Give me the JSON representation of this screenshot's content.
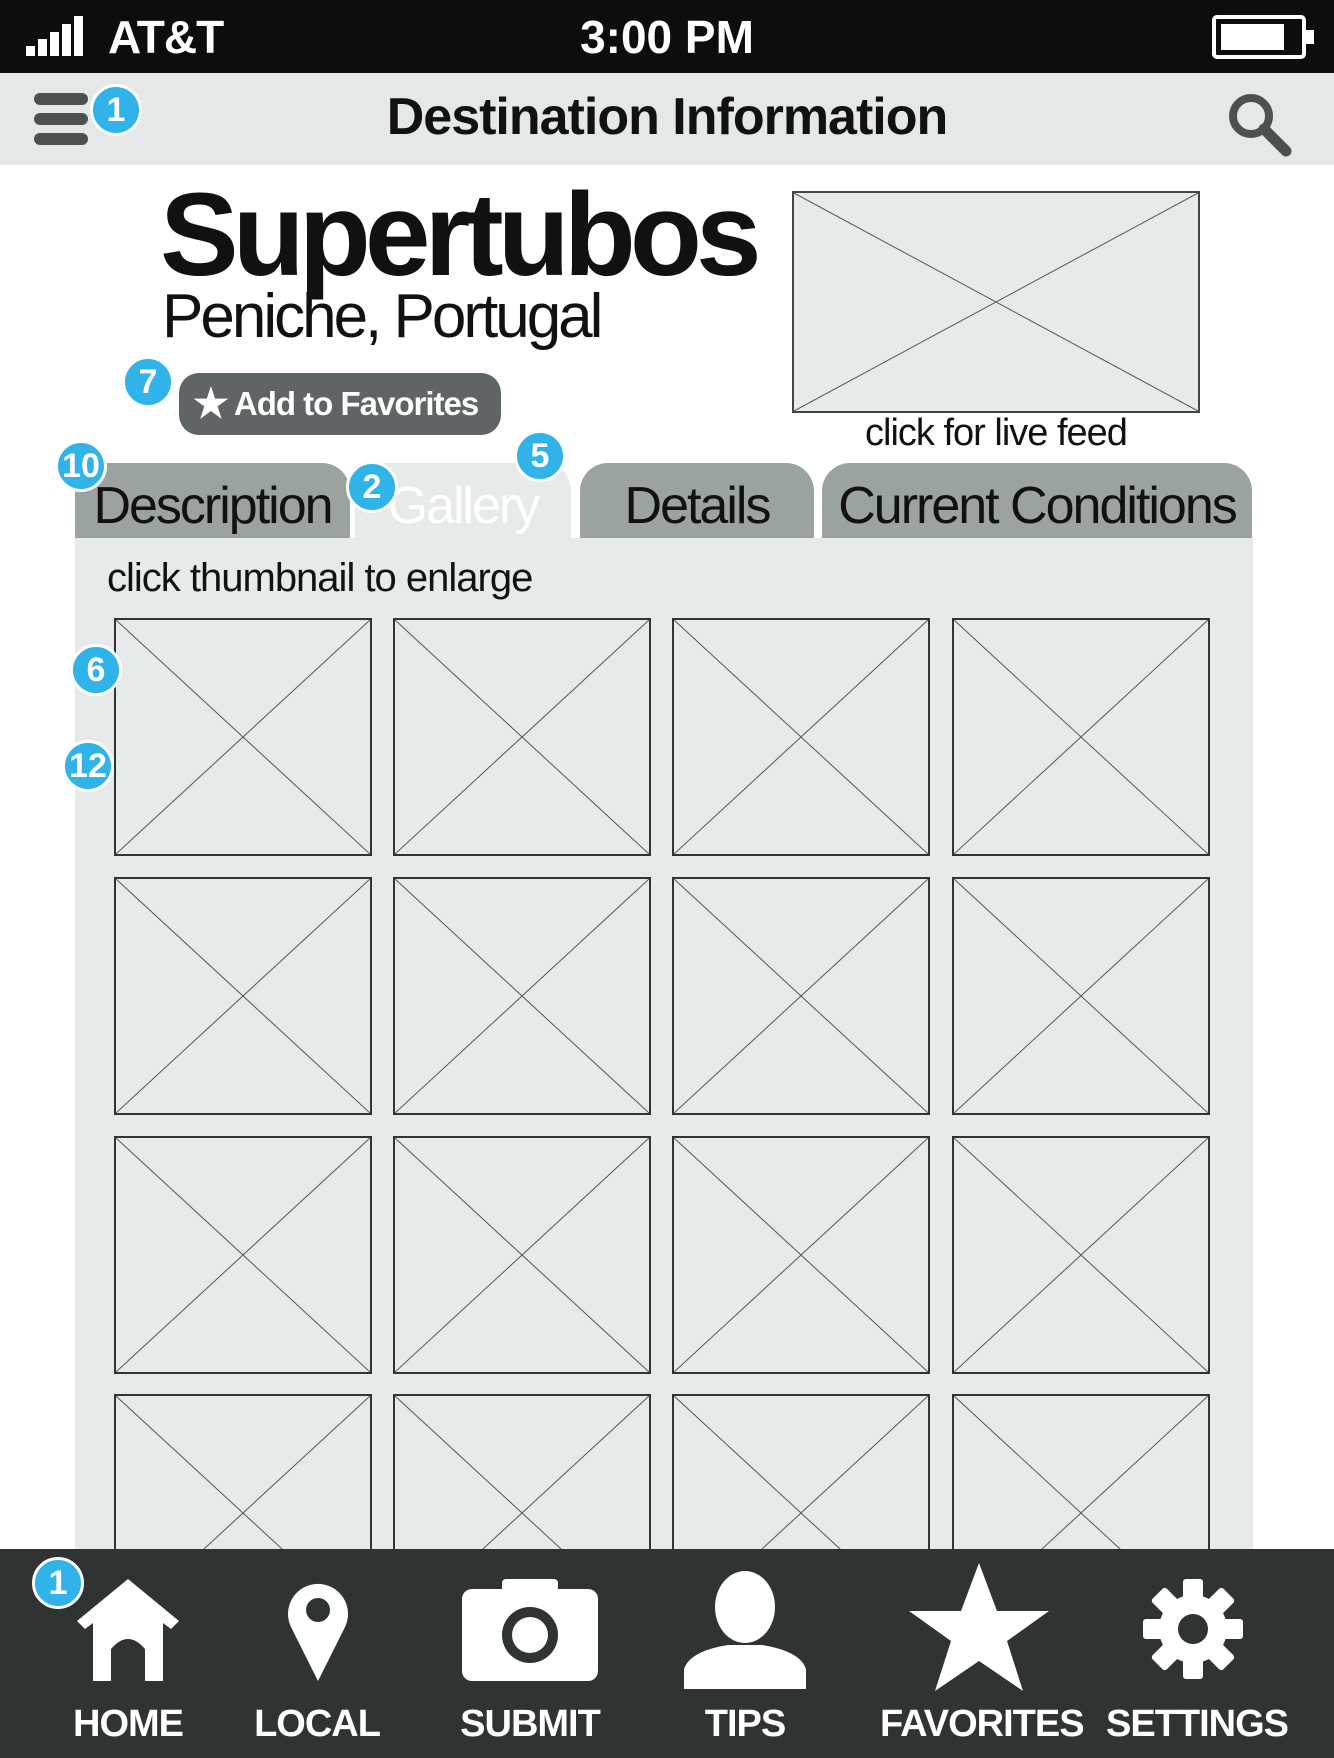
{
  "status_bar": {
    "carrier": "AT&T",
    "time": "3:00 PM",
    "signal_bars": 5,
    "battery_level": 0.8
  },
  "nav": {
    "title": "Destination Information",
    "menu_icon": "hamburger-menu-icon",
    "search_icon": "search-icon"
  },
  "spot": {
    "name": "Supertubos",
    "location": "Peniche, Portugal"
  },
  "favorites_button": {
    "icon": "star-icon",
    "label": "Add to Favorites"
  },
  "live_feed": {
    "caption": "click for live feed"
  },
  "tabs": [
    {
      "label": "Description",
      "active": false
    },
    {
      "label": "Gallery",
      "active": true
    },
    {
      "label": "Details",
      "active": false
    },
    {
      "label": "Current Conditions",
      "active": false
    }
  ],
  "gallery": {
    "hint": "click thumbnail to enlarge",
    "thumbnail_count": 16
  },
  "annotations": {
    "menu": "1",
    "favorites": "7",
    "tab_description": "10",
    "tab_gallery": "2",
    "tab_gallery_right": "5",
    "thumbnail_a": "6",
    "thumbnail_b": "12",
    "home": "1"
  },
  "bottom_nav": [
    {
      "label": "HOME",
      "icon": "home-icon"
    },
    {
      "label": "LOCAL",
      "icon": "map-pin-icon"
    },
    {
      "label": "SUBMIT",
      "icon": "camera-icon"
    },
    {
      "label": "TIPS",
      "icon": "person-icon"
    },
    {
      "label": "FAVORITES",
      "icon": "star-icon"
    },
    {
      "label": "SETTINGS",
      "icon": "gear-icon"
    }
  ],
  "colors": {
    "status_bar": "#0d0d0d",
    "nav_bar": "#e4e8e8",
    "panel": "#e6eaea",
    "tab_inactive": "#9ba2a2",
    "button": "#5f6566",
    "badge": "#2fb3e8",
    "bottom_bar": "#2f3333"
  }
}
